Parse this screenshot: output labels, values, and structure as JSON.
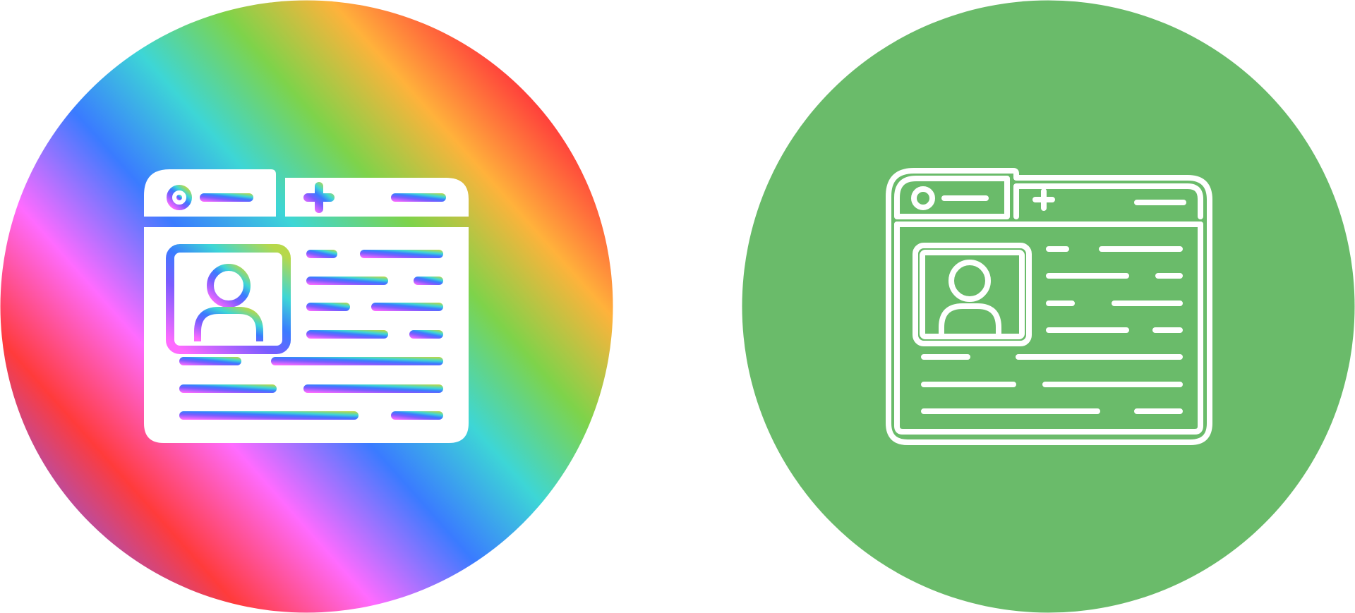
{
  "icons": [
    {
      "name": "browser-profile-icon",
      "style": "gradient",
      "background": "rainbow-gradient-circle",
      "gradient_colors": [
        "#ff3b3b",
        "#ff9a3b",
        "#ffcf4a",
        "#78d04a",
        "#3dd6d6",
        "#3a7bff",
        "#ff6bff",
        "#ff3b3b"
      ]
    },
    {
      "name": "browser-profile-icon",
      "style": "line",
      "background": "green-circle",
      "background_color": "#6abb6a",
      "stroke_color": "#ffffff"
    }
  ]
}
